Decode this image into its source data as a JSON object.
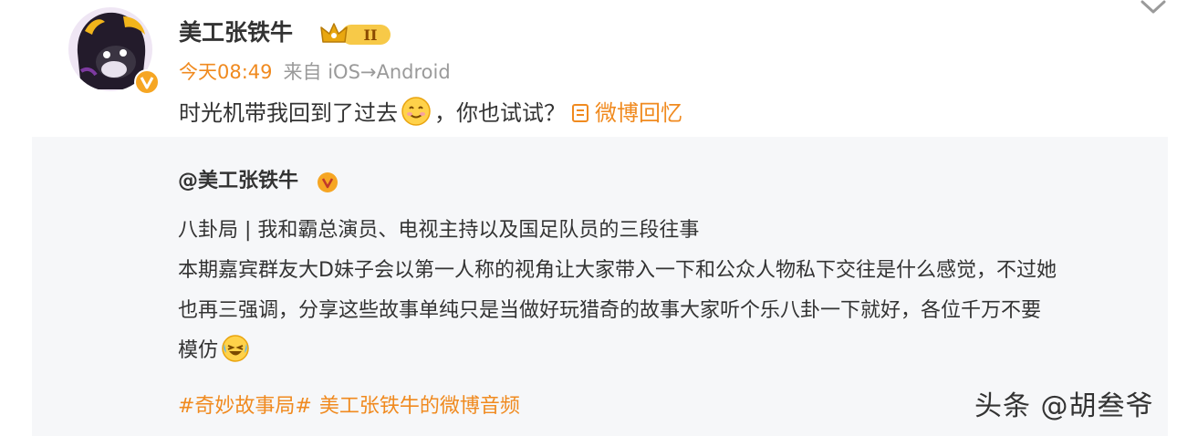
{
  "post": {
    "username": "美工张铁牛",
    "vip_badge_text": "II",
    "time": "今天08:49",
    "source": "来自 iOS→Android",
    "text_before_emoji": "时光机带我回到了过去",
    "text_after_emoji": "，你也试试？",
    "link_text": "微博回忆"
  },
  "repost": {
    "author": "@美工张铁牛",
    "lines": [
      "八卦局 | 我和霸总演员、电视主持以及国足队员的三段往事",
      "本期嘉宾群友大D妹子会以第一人称的视角让大家带入一下和公众人物私下交往是什么感觉，不过她",
      "也再三强调，分享这些故事单纯只是当做好玩猎奇的故事大家听个乐八卦一下就好，各位千万不要",
      "模仿"
    ],
    "tag1": "#奇妙故事局#",
    "tag2": "美工张铁牛的微博音频"
  },
  "watermark": "头条 @胡叁爷",
  "icons": {
    "avatar": "cartoon-avatar",
    "verified": "orange-v-badge",
    "vip": "crown-vip-badge",
    "chevron": "chevron-down-icon",
    "smile": "smile-emoji",
    "laugh": "laugh-cry-emoji",
    "link": "memory-link-icon"
  },
  "colors": {
    "accent": "#f08a1f",
    "text": "#333333",
    "meta": "#9a9a9a",
    "repost_bg": "#f6f7f9"
  }
}
